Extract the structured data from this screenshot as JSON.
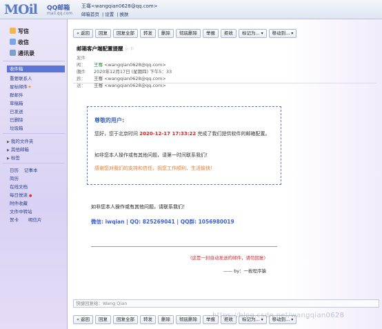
{
  "header": {
    "logo_text": "MOil",
    "logo_cn": "QQ邮箱",
    "logo_sub": "mail.qq.com",
    "user": "王骞<wangqian0628@qq.com>",
    "links": [
      "邮箱首页",
      "设置",
      "换肤"
    ]
  },
  "sidebar": {
    "compose": "写信",
    "inbox_btn": "收信",
    "contacts": "通讯录",
    "folders": [
      {
        "label": "收件箱",
        "active": true
      },
      {
        "label": "重要联系人"
      },
      {
        "label": "星标邮件",
        "star": "★"
      },
      {
        "label": "群邮件"
      },
      {
        "label": "草稿箱"
      },
      {
        "label": "已发送"
      },
      {
        "label": "已删除"
      },
      {
        "label": "垃圾箱"
      }
    ],
    "groups": [
      {
        "label": "我的文件夹",
        "badge": ""
      },
      {
        "label": "其他邮箱",
        "badge": ""
      },
      {
        "label": "标签",
        "badge": ""
      }
    ],
    "apps": [
      {
        "label": "日历",
        "extra": "记事本"
      },
      {
        "label": "简历"
      },
      {
        "label": "在线文档"
      },
      {
        "label": "每日悦读",
        "dot": "●"
      },
      {
        "label": "附件收藏"
      },
      {
        "label": "文件中转站"
      },
      {
        "label": "贺卡",
        "extra": "明信片"
      }
    ]
  },
  "toolbar": [
    "« 返回",
    "回复",
    "回复全部",
    "转发",
    "删除",
    "彻底删除",
    "举报",
    "拒收",
    "标记为...",
    "移动到..."
  ],
  "email": {
    "subject": "邮箱客户端配置提醒",
    "subject_flags": "☆ ⚐",
    "from_label": "发件人：",
    "from_name": "王骞",
    "from_addr": "<wangqian0628@qq.com>",
    "time_label": "时　间：",
    "time_value": "2020年12月17日 (星期四) 下午5：33",
    "to_label": "收件人：",
    "to_value": "王骞 <wangqian0628@qq.com>",
    "cc_label": "抄　送：",
    "cc_value": "王骞 <wangqian0628@qq.com>",
    "greeting": "尊敬的用户:",
    "body_pre": "您好，您于北京时间 ",
    "body_time": "2020-12-17 17:33:22",
    "body_post": " 完成了我们提供软件的邮箱配置。",
    "body2": "如非您本人操作或有其他问题，请第一时间联系我们！",
    "body3": "感谢您对我们的支持和信任，祝您工作顺利、生活愉快！",
    "line1": "如非您本人操作或有其他问题，请联系我们！",
    "contact": "微信: iwqian | QQ: 825269041 | QQ群: 1056980019",
    "auto_note": "(这是一封自动发送的邮件，请勿回复)",
    "signature": "—— by：一枚程序猿"
  },
  "reply_placeholder": "快捷回复给：Wang Qian",
  "watermark": "https://blog.csdn.net/wangqian0628"
}
